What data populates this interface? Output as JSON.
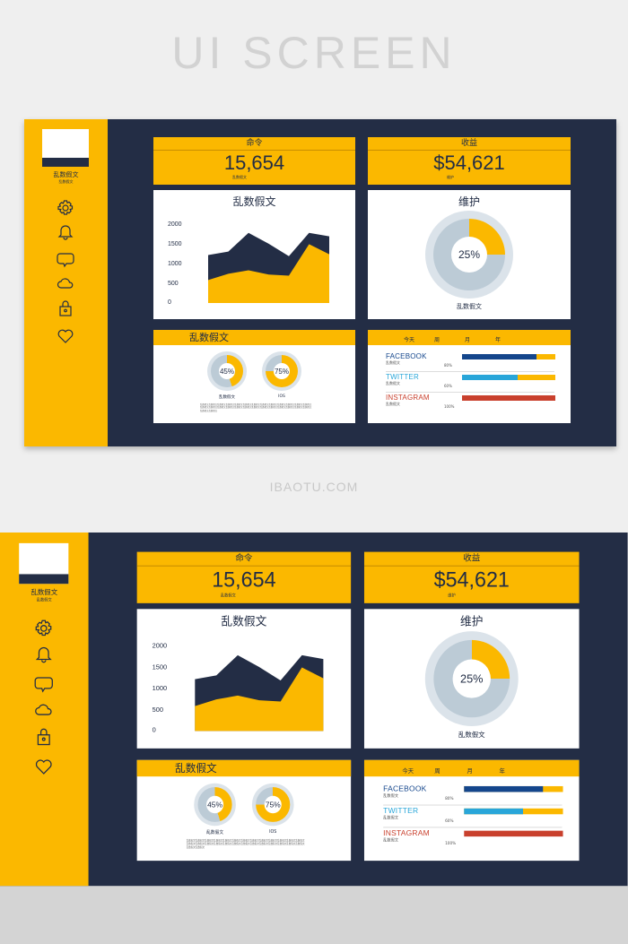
{
  "header": {
    "title": "UI SCREEN",
    "site": "IBAOTU.COM"
  },
  "colors": {
    "yellow": "#fbb800",
    "navy": "#232d45",
    "grey": "#bccbd6",
    "facebook": "#14468c",
    "twitter": "#29a6d9",
    "instagram": "#c9402d"
  },
  "sidebar": {
    "title": "乱数假文",
    "subtitle": "乱数假文",
    "icons": [
      "gear-icon",
      "bell-icon",
      "chat-icon",
      "cloud-icon",
      "lock-icon",
      "heart-icon"
    ]
  },
  "stat1": {
    "label": "命令",
    "value": "15,654",
    "sub": "乱数假文"
  },
  "stat2": {
    "label": "收益",
    "value": "$54,621",
    "sub": "维护"
  },
  "chart_data": [
    {
      "type": "area",
      "title": "乱数假文",
      "yticks": [
        "2000",
        "1500",
        "1000",
        "500",
        "0"
      ],
      "ylim": [
        0,
        2000
      ],
      "series": [
        {
          "values": [
            1230,
            1320,
            1800,
            1520,
            1200,
            1800,
            1710
          ]
        },
        {
          "values": [
            590,
            750,
            840,
            730,
            700,
            1510,
            1250
          ]
        }
      ]
    },
    {
      "type": "pie",
      "title": "维护",
      "value": 25,
      "label": "25%",
      "caption": "乱数假文"
    }
  ],
  "donuts": {
    "title": "乱数假文",
    "items": [
      {
        "value": 45,
        "label": "45%",
        "caption": "乱数假文"
      },
      {
        "value": 75,
        "label": "75%",
        "caption": "IOS"
      }
    ],
    "text": "乱数假文乱数假文乱数假文乱数假文乱数假文乱数假文乱数假文乱数假文乱数假文乱数假文乱数假文乱数假文乱数假文乱数假文乱数假文乱数假文乱数假文乱数假文乱数假文乱数假文乱数假文乱数假文乱数假文乱数假文乱数假文乱数假文乱数假文乱数假文"
  },
  "social": {
    "tabs": [
      "今天",
      "周",
      "月",
      "年"
    ],
    "rows": [
      {
        "name": "FACEBOOK",
        "sub": "乱数假文",
        "pct": "80%",
        "value": 80,
        "color": "#14468c"
      },
      {
        "name": "TWITTER",
        "sub": "乱数假文",
        "pct": "60%",
        "value": 60,
        "color": "#29a6d9"
      },
      {
        "name": "INSTAGRAM",
        "sub": "乱数假文",
        "pct": "100%",
        "value": 100,
        "color": "#c9402d"
      }
    ]
  }
}
